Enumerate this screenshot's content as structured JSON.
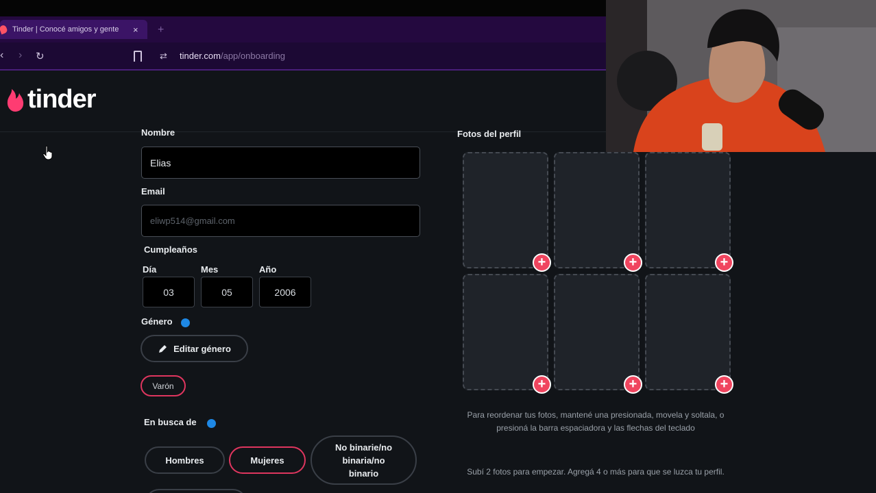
{
  "browser": {
    "tab_title": "Tinder | Conocé amigos y gente",
    "tab_close": "×",
    "new_tab": "+",
    "url_host": "tinder.com",
    "url_path": "/app/onboarding",
    "back_icon": "‹",
    "forward_icon": "›",
    "reload_icon": "↻"
  },
  "header": {
    "logo_text": "tinder"
  },
  "form": {
    "name_label": "Nombre",
    "name_value": "Elias",
    "email_label": "Email",
    "email_value": "eliwp514@gmail.com",
    "birthday_label": "Cumpleaños",
    "day_label": "Día",
    "day_value": "03",
    "month_label": "Mes",
    "month_value": "05",
    "year_label": "Año",
    "year_value": "2006",
    "gender_label": "Género",
    "edit_gender_label": "Editar género",
    "gender_chip": "Varón",
    "seeking_label": "En busca de",
    "seeking_options": [
      "Hombres",
      "Mujeres",
      "No binarie/no binaria/no binario"
    ],
    "seeking_selected": "Mujeres"
  },
  "photos": {
    "title": "Fotos del perfil",
    "hint_reorder": "Para reordenar tus fotos, mantené una presionada, movela y soltala, o presioná la barra espaciadora y las flechas del teclado",
    "hint_upload": "Subí 2 fotos para empezar. Agregá 4 o más para que se luzca tu perfil."
  },
  "colors": {
    "brand": "#fe3c72",
    "accent_selected": "#e0365f",
    "add_button": "#f0455f",
    "info_dot": "#1e88e5",
    "background": "#111418"
  },
  "icons": [
    "tinder-flame-icon",
    "back-icon",
    "forward-icon",
    "reload-icon",
    "bookmark-icon",
    "site-info-icon",
    "pencil-icon",
    "info-icon",
    "plus-icon",
    "cursor-icon"
  ]
}
